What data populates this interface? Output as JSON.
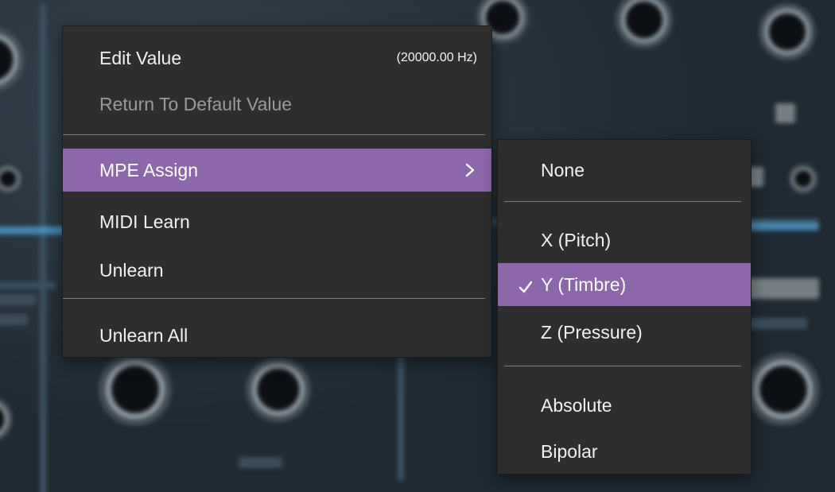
{
  "main_menu": {
    "items": [
      {
        "label": "Edit Value",
        "value": "(20000.00 Hz)",
        "state": "enabled"
      },
      {
        "label": "Return To Default Value",
        "state": "disabled"
      },
      {
        "label": "MPE Assign",
        "state": "highlighted",
        "has_submenu": true
      },
      {
        "label": "MIDI Learn",
        "state": "enabled"
      },
      {
        "label": "Unlearn",
        "state": "enabled"
      },
      {
        "label": "Unlearn All",
        "state": "enabled"
      }
    ]
  },
  "submenu": {
    "items": [
      {
        "label": "None",
        "checked": false
      },
      {
        "label": "X (Pitch)",
        "checked": false
      },
      {
        "label": "Y (Timbre)",
        "checked": true,
        "state": "highlighted"
      },
      {
        "label": "Z (Pressure)",
        "checked": false
      },
      {
        "label": "Absolute",
        "checked": false
      },
      {
        "label": "Bipolar",
        "checked": false
      }
    ]
  },
  "colors": {
    "highlight": "#8c67aa",
    "menu_background": "#2e2e2e",
    "disabled_text": "#9a9a9a"
  },
  "icons": {
    "submenu_arrow": "chevron-right-icon",
    "checkmark": "checkmark-icon"
  }
}
